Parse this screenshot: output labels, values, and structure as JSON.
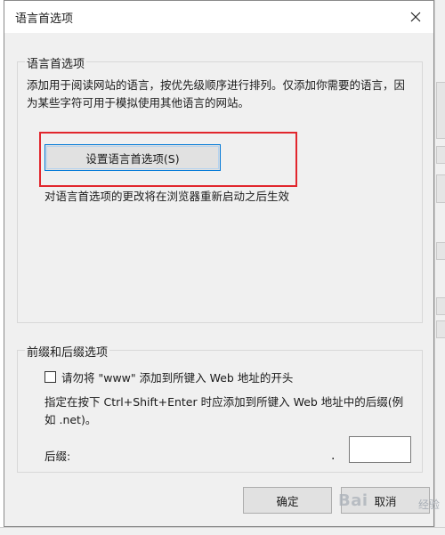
{
  "dialog": {
    "title": "语言首选项",
    "close_label": "✕"
  },
  "language_group": {
    "title": "语言首选项",
    "description": "添加用于阅读网站的语言，按优先级顺序进行排列。仅添加你需要的语言，因为某些字符可用于模拟使用其他语言的网站。",
    "button_label": "设置语言首选项(S)",
    "note": "对语言首选项的更改将在浏览器重新启动之后生效"
  },
  "prefix_group": {
    "title": "前缀和后缀选项",
    "checkbox_label": "请勿将 \"www\" 添加到所键入 Web 地址的开头",
    "checkbox_checked": false,
    "description": "指定在按下 Ctrl+Shift+Enter 时应添加到所键入 Web 地址中的后缀(例如 .net)。",
    "suffix_label": "后缀:",
    "suffix_dot": ".",
    "suffix_value": ""
  },
  "footer": {
    "ok_label": "确定",
    "cancel_label": "取消"
  },
  "watermark": {
    "text": "Bai",
    "sub": "经验"
  },
  "colors": {
    "highlight": "#e1262d",
    "focus_border": "#0078d7"
  }
}
